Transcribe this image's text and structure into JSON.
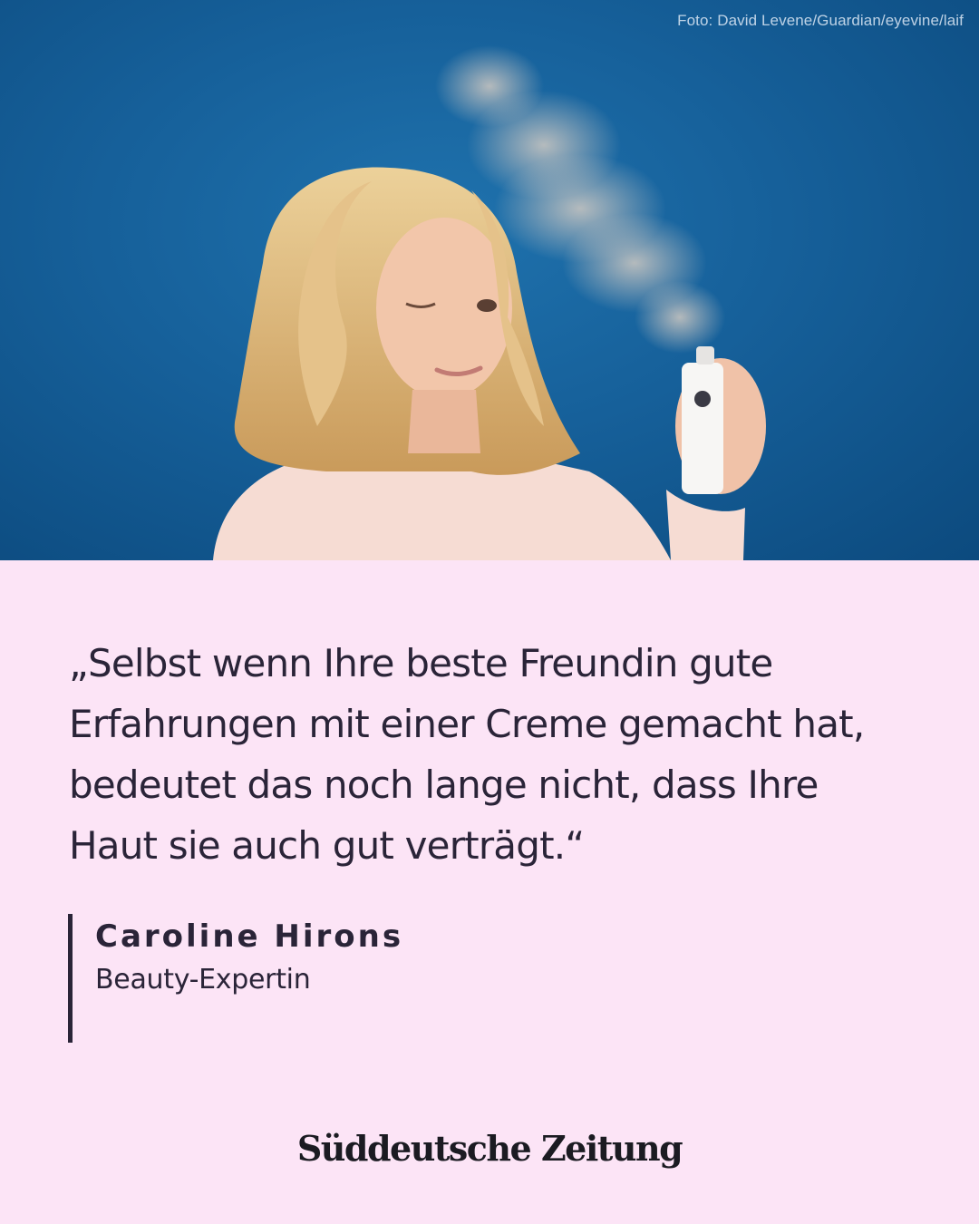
{
  "photo": {
    "credit": "Foto: David Levene/Guardian/eyevine/laif"
  },
  "quote": {
    "text": "„Selbst wenn Ihre beste Freundin gute Erfahrungen mit einer Creme gemacht hat, bedeutet das noch lange nicht, dass Ihre Haut sie auch gut verträgt.“"
  },
  "attribution": {
    "name": "Caroline Hirons",
    "role": "Beauty-Expertin"
  },
  "brand": {
    "logo_text": "Süddeutsche Zeitung"
  },
  "colors": {
    "background": "#fce4f6",
    "photo_background": "#16609a",
    "text": "#2a2438"
  }
}
